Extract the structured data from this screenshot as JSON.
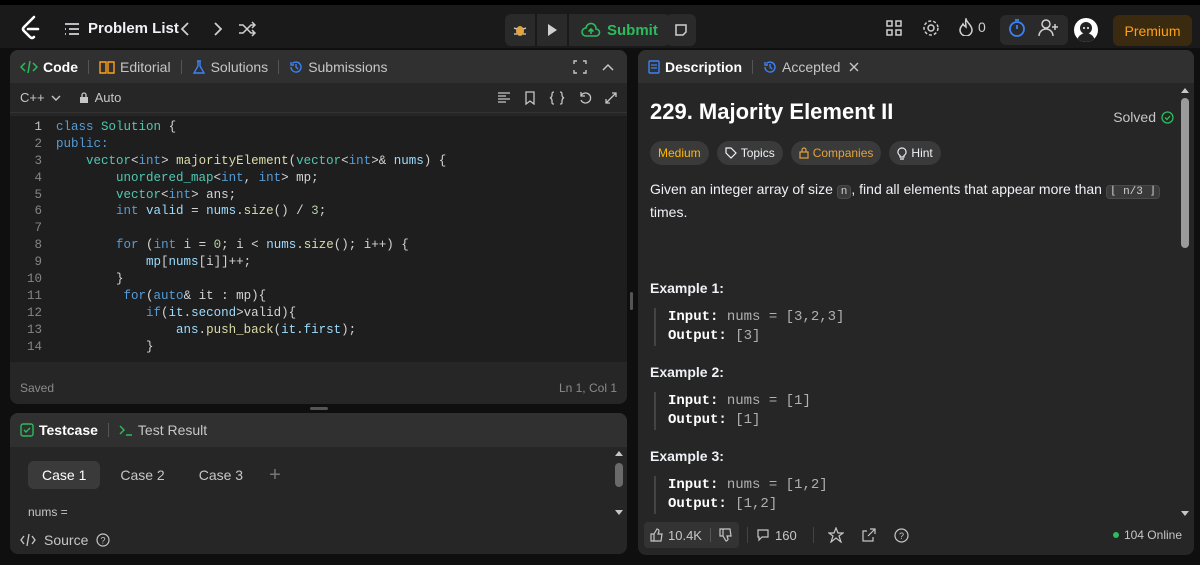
{
  "topbar": {
    "problem_list": "Problem List",
    "submit": "Submit",
    "streak_count": "0",
    "premium": "Premium"
  },
  "code_panel": {
    "tabs": [
      "Code",
      "Editorial",
      "Solutions",
      "Submissions"
    ],
    "language": "C++",
    "auto": "Auto",
    "status_saved": "Saved",
    "cursor_pos": "Ln 1, Col 1",
    "line_numbers": [
      "1",
      "2",
      "3",
      "4",
      "5",
      "6",
      "7",
      "8",
      "9",
      "10",
      "11",
      "12",
      "13",
      "14"
    ]
  },
  "testcase_panel": {
    "tabs": [
      "Testcase",
      "Test Result"
    ],
    "cases": [
      "Case 1",
      "Case 2",
      "Case 3"
    ],
    "input_label": "nums =",
    "source": "Source"
  },
  "description": {
    "tabs": [
      "Description",
      "Accepted"
    ],
    "title": "229. Majority Element II",
    "solved": "Solved",
    "tags": [
      "Medium",
      "Topics",
      "Companies",
      "Hint"
    ],
    "statement_pre": "Given an integer array of size",
    "statement_n": "n",
    "statement_mid": ", find all elements that appear more than",
    "statement_code": "⌊ n/3 ⌋",
    "statement_post": "times.",
    "examples": [
      {
        "title": "Example 1:",
        "input_label": "Input:",
        "input": "nums = [3,2,3]",
        "output_label": "Output:",
        "output": "[3]"
      },
      {
        "title": "Example 2:",
        "input_label": "Input:",
        "input": "nums = [1]",
        "output_label": "Output:",
        "output": "[1]"
      },
      {
        "title": "Example 3:",
        "input_label": "Input:",
        "input": "nums = [1,2]",
        "output_label": "Output:",
        "output": "[1,2]"
      }
    ],
    "likes": "10.4K",
    "comments": "160",
    "online": "104 Online"
  },
  "colors": {
    "accent": "#ffa116",
    "success": "#2cbb5d",
    "medium": "#ffb800"
  }
}
